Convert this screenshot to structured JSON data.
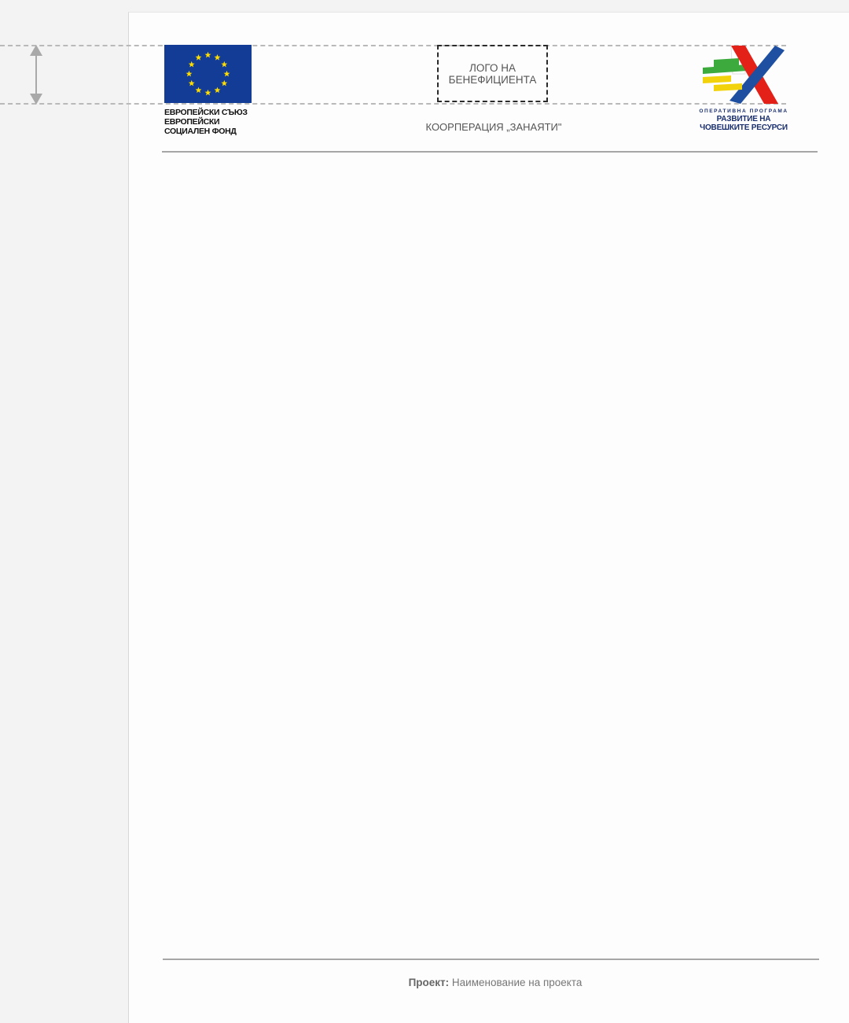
{
  "header": {
    "eu_logo": {
      "lines": [
        "ЕВРОПЕЙСКИ СЪЮЗ",
        "ЕВРОПЕЙСКИ",
        "СОЦИАЛЕН ФОНД"
      ],
      "flag_color": "#123C95",
      "star_color": "#FFDD00"
    },
    "beneficiary_placeholder": {
      "line1": "ЛОГО НА",
      "line2": "БЕНЕФИЦИЕНТА"
    },
    "organization_name": "КООРПЕРАЦИЯ „ЗАНАЯТИ\"",
    "programme_logo": {
      "small_line": "ОПЕРАТИВНА ПРОГРАМА",
      "line1": "РАЗВИТИЕ НА",
      "line2": "ЧОВЕШКИТЕ РЕСУРСИ",
      "colors": [
        "#FFFFFF",
        "#3CAA3C",
        "#E32119",
        "#1E4FA0",
        "#F2D20A"
      ]
    }
  },
  "footer": {
    "label": "Проект:",
    "value": "Наименование на проекта"
  }
}
